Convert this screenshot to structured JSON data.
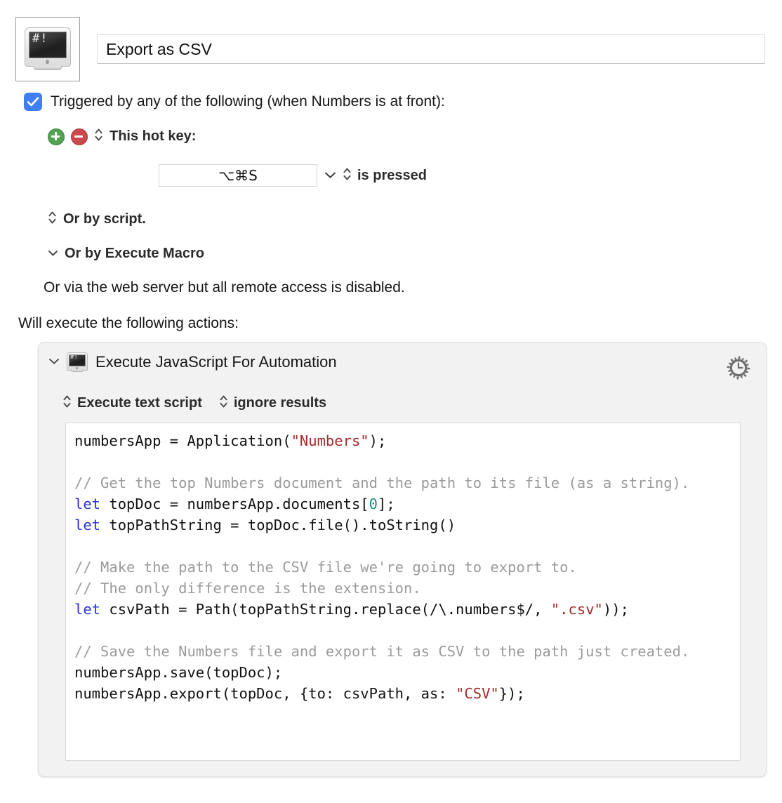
{
  "macro": {
    "icon_name": "script-monitor-icon",
    "icon_glyph": "#!",
    "name_value": "Export as CSV"
  },
  "trigger": {
    "checkbox_checked": true,
    "label": "Triggered by any of the following (when Numbers is at front):",
    "hotkey": {
      "add_button_label": "+",
      "remove_button_label": "−",
      "stepper_glyph": "⌃⌄",
      "label": "This hot key:",
      "field_value": "⌥⌘S",
      "popup_chevron": "⌄",
      "condition_label": "is pressed"
    },
    "or_by_script": {
      "stepper_glyph": "⌃⌄",
      "label": "Or by script."
    },
    "or_by_execute_macro": {
      "chevron_glyph": "⌄",
      "label": "Or by Execute Macro"
    },
    "web_server_note": "Or via the web server but all remote access is disabled."
  },
  "actions_intro": "Will execute the following actions:",
  "action": {
    "disclosure_glyph": "⌄",
    "icon_name": "script-monitor-icon",
    "icon_glyph": "#!",
    "title": "Execute JavaScript For Automation",
    "gear_icon_name": "gear-clock-icon",
    "script_mode": {
      "stepper_glyph": "⌃⌄",
      "label": "Execute text script"
    },
    "results_mode": {
      "stepper_glyph": "⌃⌄",
      "label": "ignore results"
    },
    "code_lines": [
      [
        {
          "t": "plain",
          "v": "numbersApp = Application("
        },
        {
          "t": "string",
          "v": "\"Numbers\""
        },
        {
          "t": "plain",
          "v": ");"
        }
      ],
      [],
      [
        {
          "t": "comment",
          "v": "// Get the top Numbers document and the path to its file (as a string)."
        }
      ],
      [
        {
          "t": "keyword",
          "v": "let"
        },
        {
          "t": "plain",
          "v": " topDoc = numbersApp.documents["
        },
        {
          "t": "number",
          "v": "0"
        },
        {
          "t": "plain",
          "v": "];"
        }
      ],
      [
        {
          "t": "keyword",
          "v": "let"
        },
        {
          "t": "plain",
          "v": " topPathString = topDoc.file().toString()"
        }
      ],
      [],
      [
        {
          "t": "comment",
          "v": "// Make the path to the CSV file we're going to export to."
        }
      ],
      [
        {
          "t": "comment",
          "v": "// The only difference is the extension."
        }
      ],
      [
        {
          "t": "keyword",
          "v": "let"
        },
        {
          "t": "plain",
          "v": " csvPath = Path(topPathString.replace(/\\.numbers$/, "
        },
        {
          "t": "string",
          "v": "\".csv\""
        },
        {
          "t": "plain",
          "v": "));"
        }
      ],
      [],
      [
        {
          "t": "comment",
          "v": "// Save the Numbers file and export it as CSV to the path just created."
        }
      ],
      [
        {
          "t": "plain",
          "v": "numbersApp.save(topDoc);"
        }
      ],
      [
        {
          "t": "plain",
          "v": "numbersApp.export(topDoc, {to: csvPath, as: "
        },
        {
          "t": "string",
          "v": "\"CSV\""
        },
        {
          "t": "plain",
          "v": "});"
        }
      ]
    ]
  },
  "colors": {
    "checkbox_blue": "#3f7ef4",
    "add_green": "#54a354",
    "remove_red": "#c9494c",
    "panel_gray": "#f2f2f2",
    "string_red": "#a32b28",
    "keyword_blue": "#2b31d4",
    "number_teal": "#1b8a8a",
    "comment_gray": "#9b9b9b"
  }
}
